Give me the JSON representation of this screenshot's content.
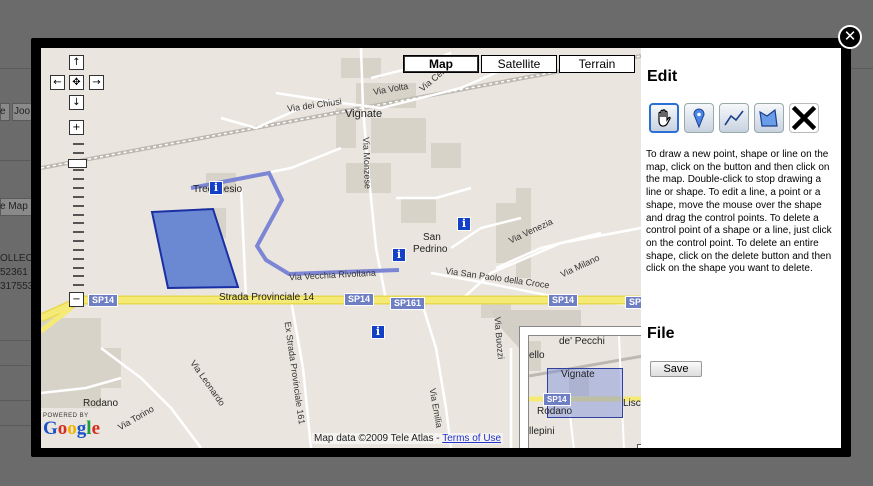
{
  "background_fragments": [
    "e",
    "Joo",
    "e Map E",
    "OLLECT",
    "52361",
    "317553"
  ],
  "close_glyph": "✕",
  "map": {
    "map_types": [
      {
        "label": "Map",
        "active": true
      },
      {
        "label": "Satellite",
        "active": false
      },
      {
        "label": "Terrain",
        "active": false
      }
    ],
    "nav": {
      "up": "↑",
      "down": "↓",
      "left": "←",
      "right": "→",
      "center": "✥"
    },
    "zoom": {
      "in": "+",
      "out": "−",
      "levels": 17,
      "level": 14
    },
    "places": [
      "Vignate",
      "Trecanesio",
      "San",
      "Pedrino",
      "Rodano"
    ],
    "roads": [
      "Via dei Chiusi",
      "Via Volta",
      "Via Cerca",
      "Via Monzese",
      "Via Vecchia Rivoltana",
      "Via San Paolo della Croce",
      "Via Milano",
      "Via Venezia",
      "Strada Provinciale 14",
      "Ex Strada Provinciale 161",
      "Via Buozzi",
      "Via Emilia",
      "Via Leonardo",
      "Via Torino"
    ],
    "shields": [
      "SP14",
      "SP14",
      "SP161",
      "SP14",
      "SP14"
    ],
    "poi_glyph": "i",
    "powered_by": "POWERED BY",
    "logo_letters": [
      {
        "ch": "G",
        "color": "#1a53c6"
      },
      {
        "ch": "o",
        "color": "#d62d20"
      },
      {
        "ch": "o",
        "color": "#f0b400"
      },
      {
        "ch": "g",
        "color": "#1a53c6"
      },
      {
        "ch": "l",
        "color": "#1f9d3a"
      },
      {
        "ch": "e",
        "color": "#d62d20"
      }
    ],
    "attribution": "Map data ©2009 Tele Atlas - ",
    "terms_link": "Terms of Use",
    "overview": {
      "places": [
        "de' Pecchi",
        "ello",
        "Vignate",
        "SP14",
        "Rodano",
        "Lisc",
        "llepini"
      ],
      "corner_glyph": "↘"
    },
    "shape_fill": "#6b88d3",
    "shape_stroke": "#1a2fa3",
    "line_color": "#7c86d4"
  },
  "panel": {
    "edit_title": "Edit",
    "tools": [
      {
        "name": "pan-tool",
        "icon": "hand-icon",
        "selected": true
      },
      {
        "name": "point-tool",
        "icon": "pin-icon",
        "selected": false
      },
      {
        "name": "line-tool",
        "icon": "line-icon",
        "selected": false
      },
      {
        "name": "shape-tool",
        "icon": "polygon-icon",
        "selected": false
      },
      {
        "name": "delete-tool",
        "icon": "delete-x-icon",
        "selected": false
      }
    ],
    "help_text": "To draw a new point, shape or line on the map, click on the button and then click on the map. Double-click to stop drawing a line or shape. To edit a line, a point or a shape, move the mouse over the shape and drag the control points. To delete a control point of a shape or a line, just click on the control point. To delete an entire shape, click on the delete button and then click on the shape you want to delete.",
    "file_title": "File",
    "save_label": "Save"
  }
}
